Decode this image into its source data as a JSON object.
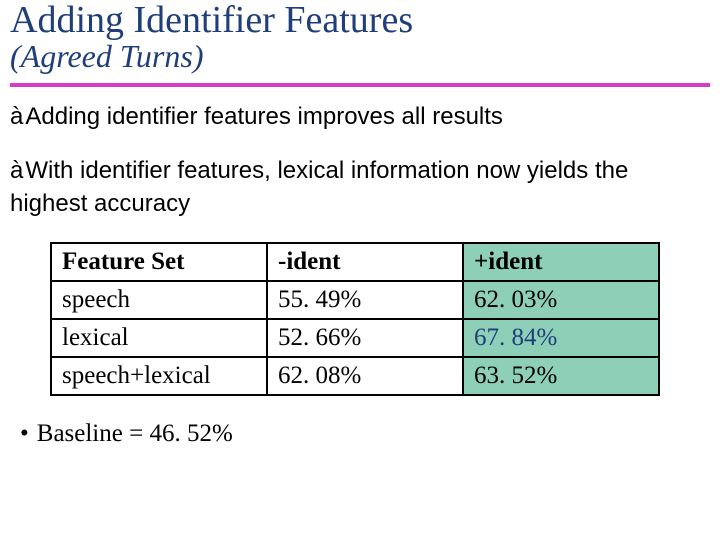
{
  "title": "Adding Identifier Features",
  "subtitle": "(Agreed Turns)",
  "bullets": [
    "Adding identifier features improves all results",
    "With identifier features, lexical information now yields the highest accuracy"
  ],
  "table": {
    "headers": [
      "Feature Set",
      "-ident",
      "+ident"
    ],
    "rows": [
      {
        "label": "speech",
        "minus": "55. 49%",
        "plus": "62. 03%",
        "highlight": false
      },
      {
        "label": "lexical",
        "minus": "52. 66%",
        "plus": "67. 84%",
        "highlight": true
      },
      {
        "label": "speech+lexical",
        "minus": "62. 08%",
        "plus": "63. 52%",
        "highlight": false
      }
    ]
  },
  "baseline": "Baseline = 46. 52%",
  "arrow_glyph": "à",
  "bullet_glyph": "•"
}
